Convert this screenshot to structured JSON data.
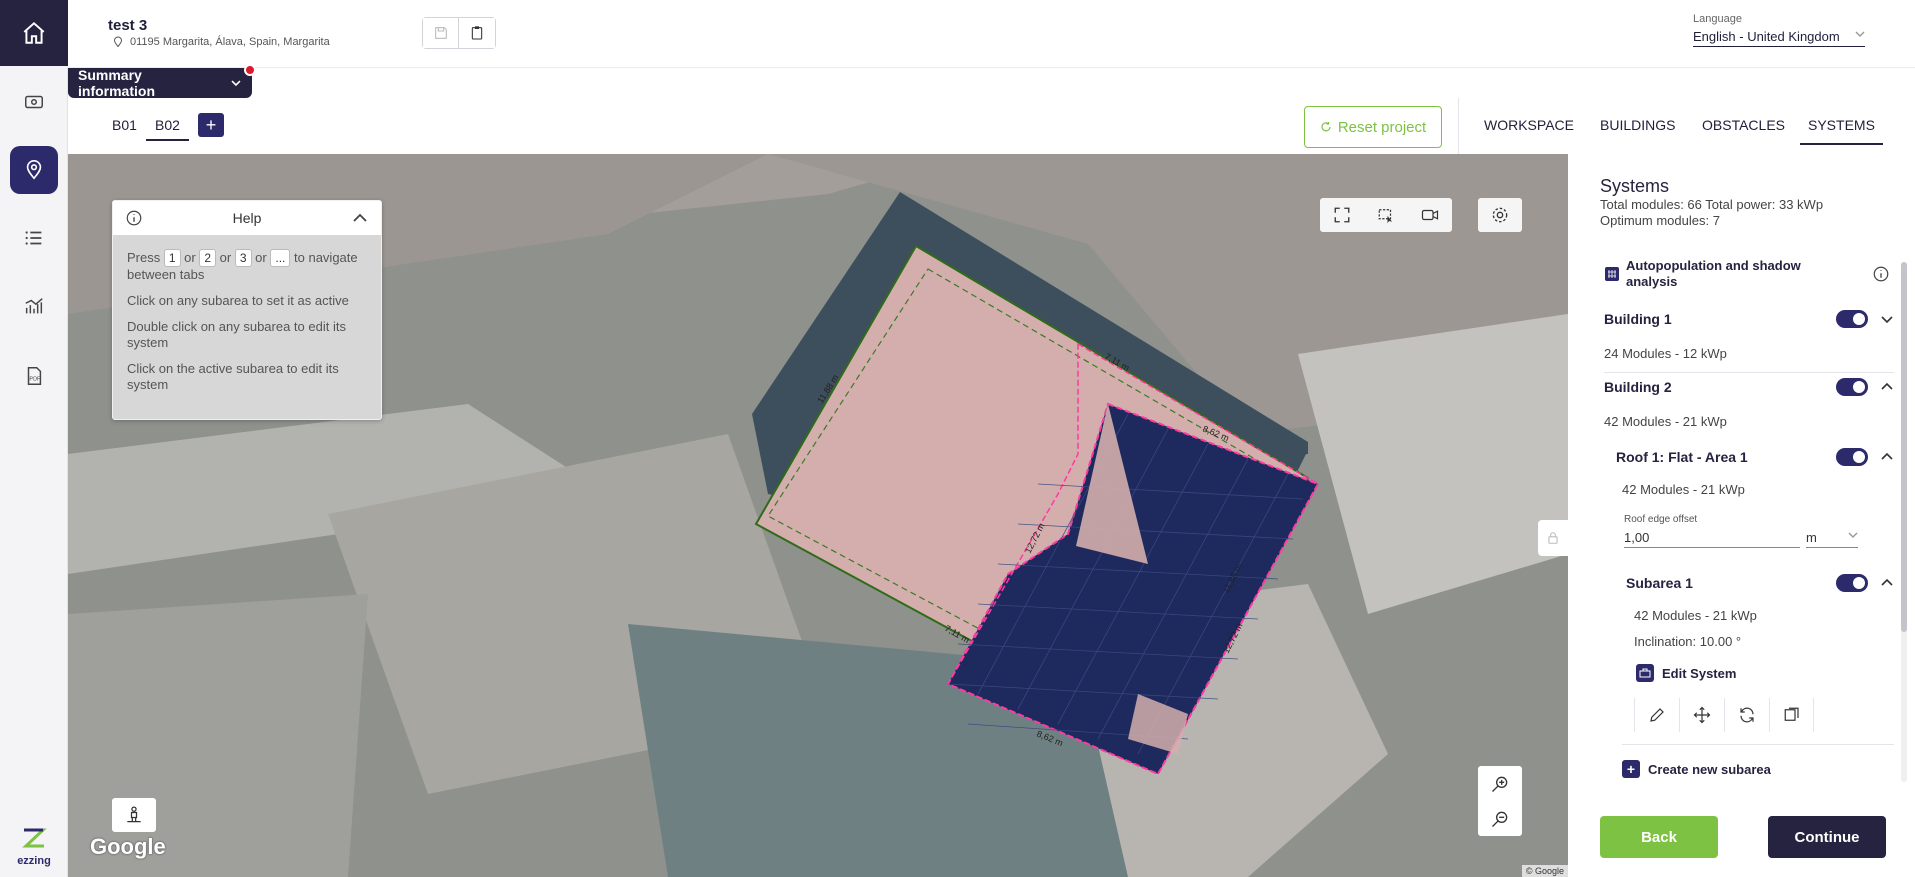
{
  "header": {
    "project_title": "test 3",
    "address": "01195 Margarita, Álava, Spain, Margarita",
    "language_label": "Language",
    "language_value": "English - United Kingdom"
  },
  "summary": {
    "label": "Summary information"
  },
  "building_tabs": [
    {
      "label": "B01"
    },
    {
      "label": "B02"
    }
  ],
  "reset_label": "Reset project",
  "nav_tabs": [
    {
      "label": "WORKSPACE"
    },
    {
      "label": "BUILDINGS"
    },
    {
      "label": "OBSTACLES"
    },
    {
      "label": "SYSTEMS"
    }
  ],
  "help": {
    "title": "Help",
    "press_word": "Press",
    "keys": [
      "1",
      "2",
      "3",
      "..."
    ],
    "or_word": "or",
    "to_word": "to",
    "nav_text": "navigate between tabs",
    "tip2": "Click on any subarea to set it as active",
    "tip3": "Double click on any subarea to edit its system",
    "tip4": "Click on the active subarea to edit its system"
  },
  "map": {
    "google_label": "Google",
    "copyright": "© Google",
    "dimensions": [
      "7,11 m",
      "8,62 m",
      "12,72 m",
      "11,88 m",
      "7,11 m",
      "8,62 m",
      "12,72 m",
      "11,88 m"
    ]
  },
  "systems": {
    "title": "Systems",
    "summary_line1": "Total modules: 66 Total power: 33 kWp",
    "summary_line2": "Optimum modules: 7",
    "autopop_label": "Autopopulation and shadow analysis",
    "building1": {
      "name": "Building 1",
      "meta": "24 Modules - 12 kWp"
    },
    "building2": {
      "name": "Building 2",
      "meta": "42 Modules - 21 kWp"
    },
    "roof": {
      "name": "Roof 1: Flat - Area 1",
      "meta": "42 Modules - 21 kWp"
    },
    "offset": {
      "label": "Roof edge offset",
      "value": "1,00",
      "unit": "m"
    },
    "subarea": {
      "name": "Subarea 1",
      "meta": "42 Modules - 21 kWp",
      "inclination": "Inclination: 10.00 °"
    },
    "edit_label": "Edit System",
    "create_label": "Create new subarea",
    "back_label": "Back",
    "continue_label": "Continue"
  },
  "brand": {
    "name": "ezzing"
  },
  "colors": {
    "navy": "#25233f",
    "accent_green": "#7dc242",
    "alert_red": "#e0182d",
    "module_blue": "#1e2a5e"
  }
}
